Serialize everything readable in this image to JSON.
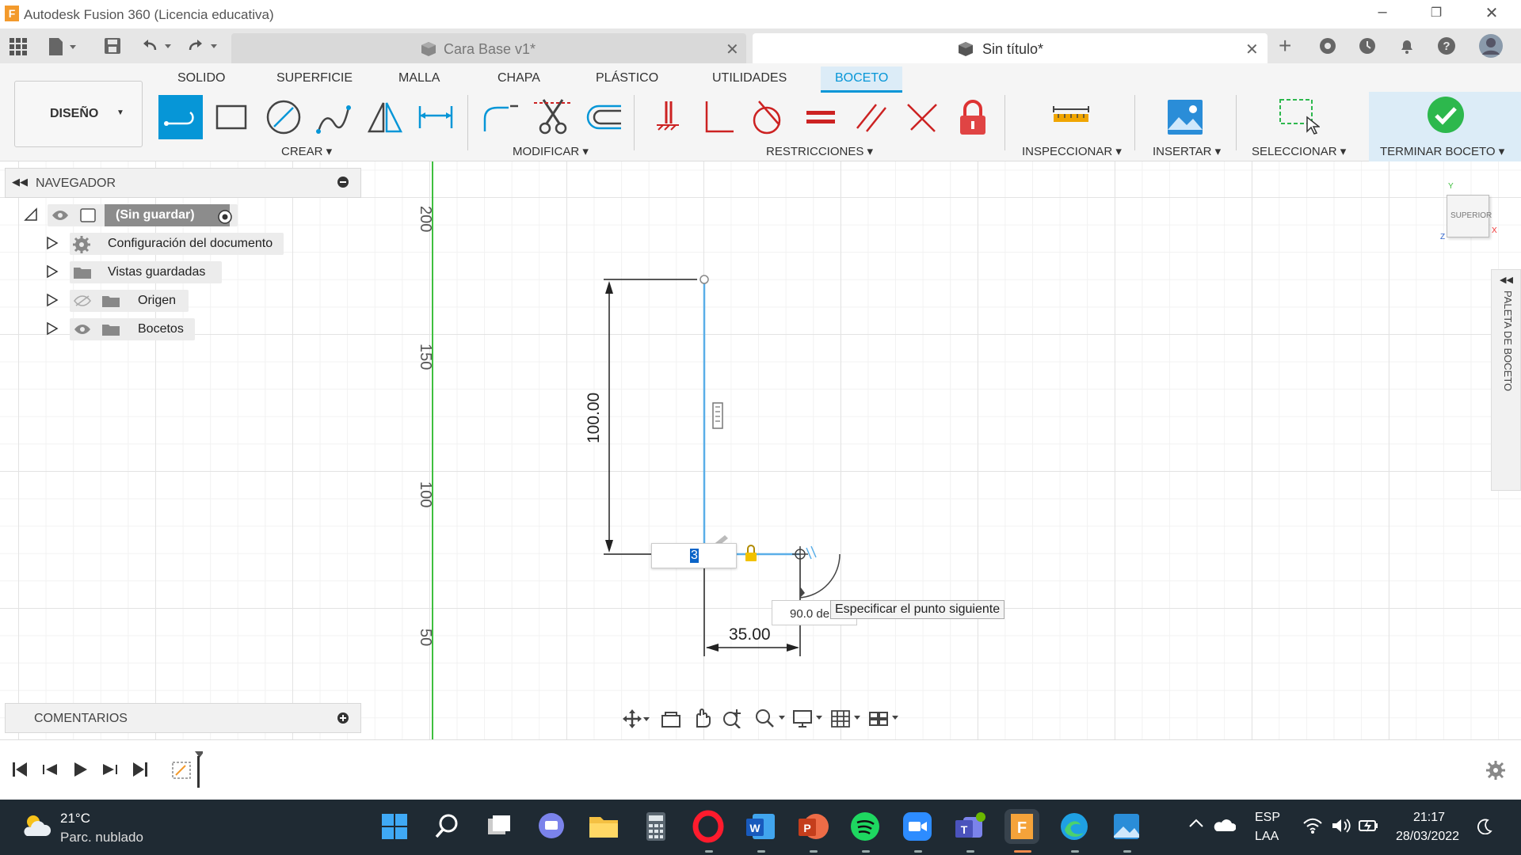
{
  "window": {
    "title": "Autodesk Fusion 360 (Licencia educativa)"
  },
  "tabs": [
    {
      "label": "Cara Base v1*",
      "active": false
    },
    {
      "label": "Sin título*",
      "active": true
    }
  ],
  "ribbon": {
    "workspace": "DISEÑO",
    "tabs": [
      "SOLIDO",
      "SUPERFICIE",
      "MALLA",
      "CHAPA",
      "PLÁSTICO",
      "UTILIDADES",
      "BOCETO"
    ],
    "active_tab": "BOCETO",
    "groups": [
      "CREAR",
      "MODIFICAR",
      "RESTRICCIONES",
      "INSPECCIONAR",
      "INSERTAR",
      "SELECCIONAR",
      "TERMINAR BOCETO"
    ]
  },
  "navigator": {
    "title": "NAVEGADOR",
    "root": "(Sin guardar)",
    "items": [
      {
        "label": "Configuración del documento",
        "icon": "gear-icon"
      },
      {
        "label": "Vistas guardadas",
        "icon": "folder-icon"
      },
      {
        "label": "Origen",
        "icon": "folder-icon",
        "visibility": "hidden"
      },
      {
        "label": "Bocetos",
        "icon": "folder-icon",
        "visibility": "visible"
      }
    ]
  },
  "comments": {
    "title": "COMENTARIOS"
  },
  "sketch": {
    "ruler_labels": [
      "200",
      "150",
      "100",
      "50"
    ],
    "dim_vertical": "100.00",
    "dim_horizontal": "35.00",
    "length_input_value": "3",
    "angle_value": "90.0 deg",
    "angle_display": "90.0 de",
    "tooltip": "Especificar el punto siguiente"
  },
  "viewcube": {
    "label": "SUPERIOR",
    "axis_x": "X",
    "axis_y": "Y",
    "axis_z": "Z"
  },
  "palette": {
    "label": "PALETA DE BOCETO"
  },
  "taskbar": {
    "weather_temp": "21°C",
    "weather_desc": "Parc. nublado",
    "lang_1": "ESP",
    "lang_2": "LAA",
    "time": "21:17",
    "date": "28/03/2022"
  },
  "colors": {
    "accent": "#0696d7",
    "sketch_line": "#5aaee8",
    "dimension": "#111111",
    "axis_green": "#3fbf3f",
    "finish_green": "#2db84d",
    "taskbar_bg": "#1f2a33"
  }
}
